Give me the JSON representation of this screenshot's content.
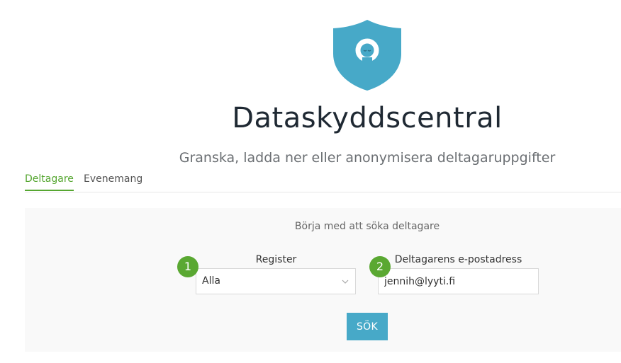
{
  "header": {
    "title": "Dataskyddscentral",
    "subtitle": "Granska, ladda ner eller anonymisera deltagaruppgifter",
    "logo_icon": "shield-logo-icon",
    "logo_color": "#47a9c8"
  },
  "tabs": [
    {
      "label": "Deltagare",
      "active": true
    },
    {
      "label": "Evenemang",
      "active": false
    }
  ],
  "search": {
    "hint": "Börja med att söka deltagare",
    "register": {
      "badge": "1",
      "label": "Register",
      "value": "Alla",
      "icon": "chevron-down-icon"
    },
    "email": {
      "badge": "2",
      "label": "Deltagarens e-postadress",
      "value": "jennih@lyyti.fi"
    },
    "button_label": "SÖK"
  },
  "colors": {
    "accent_green": "#55a630",
    "button_blue": "#47a9c8",
    "panel_bg": "#f9f9f9"
  }
}
